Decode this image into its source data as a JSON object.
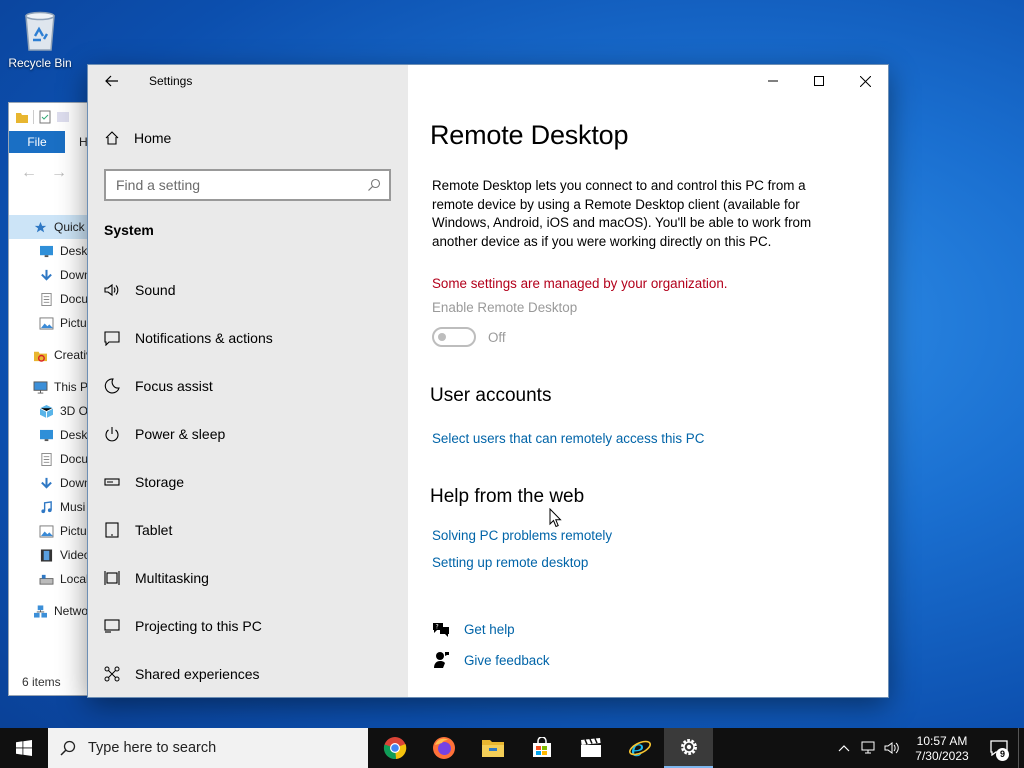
{
  "desktop": {
    "recycle_bin_label": "Recycle Bin"
  },
  "explorer": {
    "file_tab": "File",
    "home_tab": "H",
    "tree": [
      {
        "label": "Quick",
        "icon": "star-icon",
        "top": true,
        "selected": true
      },
      {
        "label": "Deskt",
        "icon": "desktop-folder-icon"
      },
      {
        "label": "Down",
        "icon": "download-arrow-icon"
      },
      {
        "label": "Docu",
        "icon": "document-icon"
      },
      {
        "label": "Pictu",
        "icon": "picture-icon"
      },
      {
        "label": "",
        "spacer": true
      },
      {
        "label": "Creativ",
        "icon": "creative-cloud-icon",
        "top": true
      },
      {
        "label": "",
        "spacer": true
      },
      {
        "label": "This PC",
        "icon": "computer-icon",
        "top": true
      },
      {
        "label": "3D O",
        "icon": "cube-3d-icon"
      },
      {
        "label": "Deskt",
        "icon": "desktop-folder-icon"
      },
      {
        "label": "Docu",
        "icon": "document-icon"
      },
      {
        "label": "Down",
        "icon": "download-arrow-icon"
      },
      {
        "label": "Musi",
        "icon": "music-note-icon"
      },
      {
        "label": "Pictu",
        "icon": "picture-icon"
      },
      {
        "label": "Video",
        "icon": "film-icon"
      },
      {
        "label": "Local",
        "icon": "drive-icon"
      },
      {
        "label": "",
        "spacer": true
      },
      {
        "label": "Netwo",
        "icon": "network-icon",
        "top": true
      }
    ],
    "status": "6 items"
  },
  "settings": {
    "window_title": "Settings",
    "home_label": "Home",
    "search_placeholder": "Find a setting",
    "section_header": "System",
    "nav_items": [
      {
        "label": "Sound",
        "icon": "speaker-icon"
      },
      {
        "label": "Notifications & actions",
        "icon": "notification-icon"
      },
      {
        "label": "Focus assist",
        "icon": "moon-icon"
      },
      {
        "label": "Power & sleep",
        "icon": "power-icon"
      },
      {
        "label": "Storage",
        "icon": "storage-icon"
      },
      {
        "label": "Tablet",
        "icon": "tablet-icon"
      },
      {
        "label": "Multitasking",
        "icon": "multitasking-icon"
      },
      {
        "label": "Projecting to this PC",
        "icon": "projecting-icon"
      },
      {
        "label": "Shared experiences",
        "icon": "shared-experiences-icon"
      }
    ],
    "page": {
      "title": "Remote Desktop",
      "description": "Remote Desktop lets you connect to and control this PC from a remote device by using a Remote Desktop client (available for Windows, Android, iOS and macOS). You'll be able to work from another device as if you were working directly on this PC.",
      "org_notice": "Some settings are managed by your organization.",
      "enable_label": "Enable Remote Desktop",
      "toggle_state": "Off",
      "user_accounts_heading": "User accounts",
      "select_users_link": "Select users that can remotely access this PC",
      "help_heading": "Help from the web",
      "help_links": [
        "Solving PC problems remotely",
        "Setting up remote desktop"
      ],
      "get_help": "Get help",
      "give_feedback": "Give feedback"
    }
  },
  "taskbar": {
    "search_placeholder": "Type here to search",
    "apps": [
      "chrome-icon",
      "firefox-icon",
      "file-explorer-icon",
      "store-icon",
      "video-editor-icon",
      "internet-explorer-icon",
      "settings-gear-icon"
    ],
    "active_app": "settings-gear-icon",
    "time": "10:57 AM",
    "date": "7/30/2023",
    "notification_count": "9"
  },
  "colors": {
    "accent": "#0064a8",
    "warning": "#b3001b",
    "nav_bg": "#eaeaea",
    "taskbar_bg": "#101010"
  }
}
